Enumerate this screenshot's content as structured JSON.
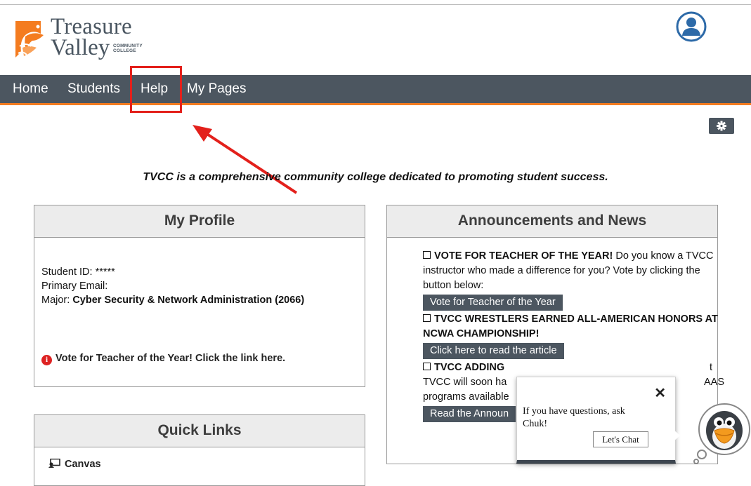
{
  "logo": {
    "line1": "Treasure",
    "line2": "Valley",
    "line3a": "COMMUNITY",
    "line3b": "COLLEGE"
  },
  "nav": {
    "items": [
      {
        "label": "Home"
      },
      {
        "label": "Students"
      },
      {
        "label": "Help"
      },
      {
        "label": "My Pages"
      }
    ]
  },
  "tagline": "TVCC is a comprehensive community college dedicated to promoting student success.",
  "profile": {
    "title": "My Profile",
    "student_id_label": "Student ID:",
    "student_id_value": "*****",
    "email_label": "Primary Email:",
    "major_label": "Major:",
    "major_value": "Cyber Security & Network Administration (2066)",
    "vote_link": "Vote for Teacher of the Year! Click the link here."
  },
  "news": {
    "title": "Announcements and News",
    "item1_bold": "VOTE FOR TEACHER OF THE YEAR!",
    "item1_text": "Do you know a TVCC instructor who made a difference for you? Vote by clicking the button below:",
    "button1": "Vote for Teacher of the Year",
    "item2_bold": "TVCC WRESTLERS EARNED ALL-AMERICAN HONORS AT NCWA CHAMPIONSHIP!",
    "button2": "Click here to read the article",
    "item3_bold": "TVCC ADDING",
    "item3_tail": "t",
    "item3_line2a": "TVCC will soon ha",
    "item3_line2b": "AAS",
    "item3_line3": "programs available",
    "button3": "Read the Announ"
  },
  "quick_links": {
    "title": "Quick Links",
    "items": [
      {
        "label": "Canvas"
      }
    ]
  },
  "chat": {
    "text": "If you have questions, ask Chuk!",
    "button": "Let's Chat",
    "close": "✕"
  },
  "colors": {
    "nav_bg": "#4c5660",
    "accent": "#f47c20",
    "highlight": "#e3201b"
  }
}
